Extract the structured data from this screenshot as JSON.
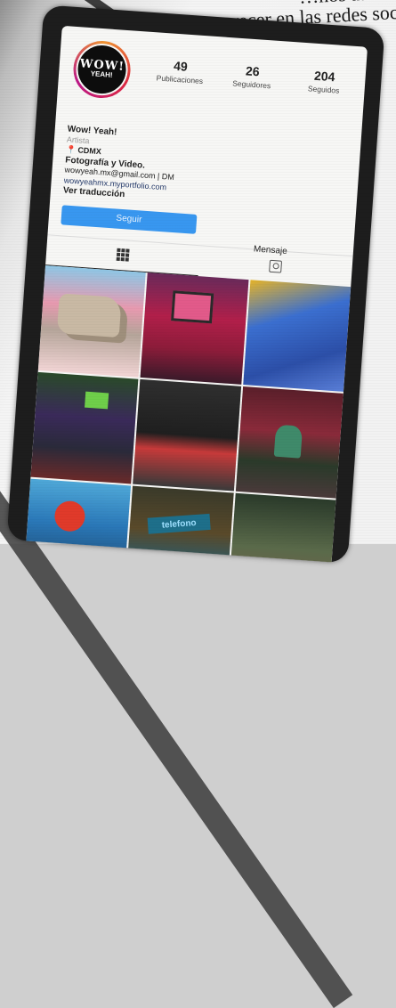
{
  "article": {
    "headline_line1": "…ños atrás volv",
    "headline_line2": "aparecer en las redes socia"
  },
  "profile": {
    "avatar_text": "WOW!",
    "avatar_subtext": "YEAH!",
    "stats": [
      {
        "value": "49",
        "label": "Publicaciones"
      },
      {
        "value": "26",
        "label": "Seguidores"
      },
      {
        "value": "204",
        "label": "Seguidos"
      }
    ],
    "name": "Wow! Yeah!",
    "category": "Artista",
    "location": "CDMX",
    "description": "Fotografía y Video.",
    "contact_line1": "wowyeah.mx@gmail.com | DM",
    "contact_line2": "wowyeahmx.myportfolio.com",
    "translate": "Ver traducción"
  },
  "actions": {
    "follow_label": "Seguir",
    "message_label": "Mensaje"
  },
  "tabs": {
    "grid_icon": "grid-icon",
    "tagged_icon": "tagged-icon"
  },
  "grid_sign_text": "telefono",
  "colors": {
    "follow_button": "#3897f0",
    "avatar_ring": "#dc2743"
  }
}
